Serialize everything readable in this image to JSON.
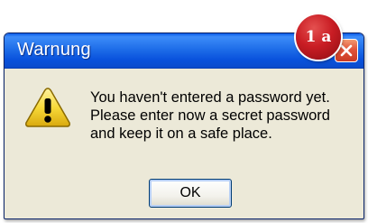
{
  "window": {
    "title": "Warnung",
    "close_icon": "close-x-icon"
  },
  "dialog": {
    "icon": "warning-icon",
    "message_lines": [
      "You haven't entered a password yet.",
      "Please enter now a secret password",
      "and keep it on a safe place."
    ],
    "ok_label": "OK"
  },
  "badge": {
    "label": "1 a",
    "color": "#c91d24"
  },
  "colors": {
    "titlebar": "#1f6ee9",
    "dialog_background": "#ece9d8",
    "close_button": "#e2543a"
  }
}
